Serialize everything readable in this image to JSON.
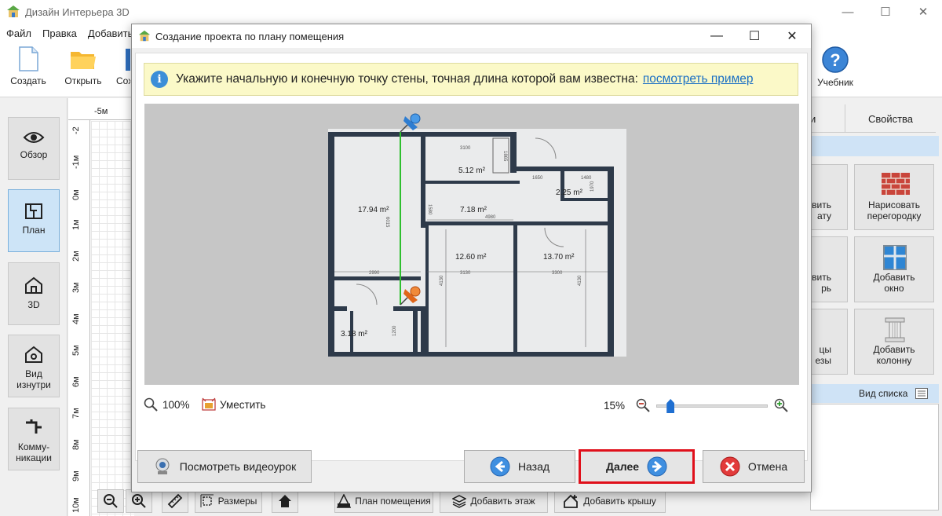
{
  "app": {
    "title": "Дизайн Интерьера 3D",
    "window_controls": [
      "—",
      "☐",
      "✕"
    ]
  },
  "menu": [
    "Файл",
    "Правка",
    "Добавить"
  ],
  "toolbar": {
    "create": "Создать",
    "open": "Открыть",
    "save_partial": "Сох",
    "tutorial": "Учебник"
  },
  "left_panel": [
    {
      "label": "Обзор",
      "icon": "eye-icon"
    },
    {
      "label": "План",
      "icon": "plan-icon",
      "active": true
    },
    {
      "label": "3D",
      "icon": "house-3d-icon"
    },
    {
      "label": "Вид\nизнутри",
      "icon": "interior-view-icon"
    },
    {
      "label": "Комму-\nникации",
      "icon": "pipes-icon"
    }
  ],
  "ruler": {
    "top": [
      "-5м"
    ],
    "left": [
      "-2",
      "-1м",
      "0м",
      "1м",
      "2м",
      "3м",
      "4м",
      "5м",
      "6м",
      "7м",
      "8м",
      "9м",
      "10м"
    ]
  },
  "right_panel": {
    "tab_partial": "и",
    "tab_properties": "Свойства",
    "cards": [
      {
        "label": "вить\nату",
        "icon": "room-icon"
      },
      {
        "label": "Нарисовать\nперегородку",
        "icon": "brick-wall-icon"
      },
      {
        "label": "вить\nрь",
        "icon": "door-icon"
      },
      {
        "label": "Добавить\nокно",
        "icon": "window-icon"
      },
      {
        "label": "цы\nезы",
        "icon": "stairs-icon"
      },
      {
        "label": "Добавить\nколонну",
        "icon": "column-icon"
      }
    ],
    "list_view": "Вид списка"
  },
  "bottom_toolbar": {
    "dimensions": "Размеры",
    "room_plan": "План помещения",
    "add_floor": "Добавить этаж",
    "add_roof": "Добавить крышу"
  },
  "dialog": {
    "title": "Создание проекта по плану помещения",
    "controls": [
      "—",
      "☐",
      "✕"
    ],
    "info_text": "Укажите начальную и конечную точку стены, точная длина которой вам известна:",
    "info_link": "посмотреть пример",
    "zoom_left": "100%",
    "fit": "Уместить",
    "zoom_right": "15%",
    "zoom_level": 0.1,
    "buttons": {
      "video": "Посмотреть видеоурок",
      "back": "Назад",
      "next": "Далее",
      "cancel": "Отмена"
    },
    "plan": {
      "rooms": [
        "17.94 m²",
        "5.12 m²",
        "2.25 m²",
        "7.18 m²",
        "12.60 m²",
        "13.70 m²",
        "3.18 m²"
      ],
      "dims": [
        "3100",
        "1865",
        "1650",
        "1480",
        "1970",
        "1580",
        "4980",
        "6015",
        "2990",
        "3130",
        "3300",
        "4130",
        "4130",
        "1200"
      ]
    }
  }
}
